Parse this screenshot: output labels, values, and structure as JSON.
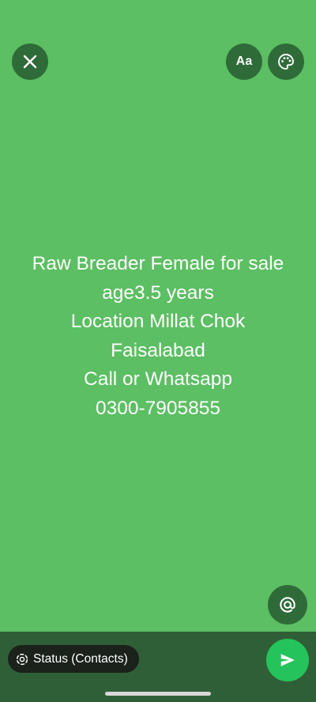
{
  "toolbar": {
    "close_icon": "close-icon",
    "font_button_label": "Aa",
    "palette_icon": "palette-icon"
  },
  "status": {
    "lines": [
      "Raw Breader Female for sale",
      "age3.5 years",
      "Location Millat Chok",
      "Faisalabad",
      "Call or Whatsapp",
      "0300-7905855"
    ],
    "background_color": "#5cbf63"
  },
  "mention": {
    "icon": "at-sign-icon"
  },
  "bottom_bar": {
    "audience_label": "Status (Contacts)",
    "audience_icon": "status-ring-icon",
    "send_icon": "send-icon",
    "send_color": "#25c35b"
  }
}
